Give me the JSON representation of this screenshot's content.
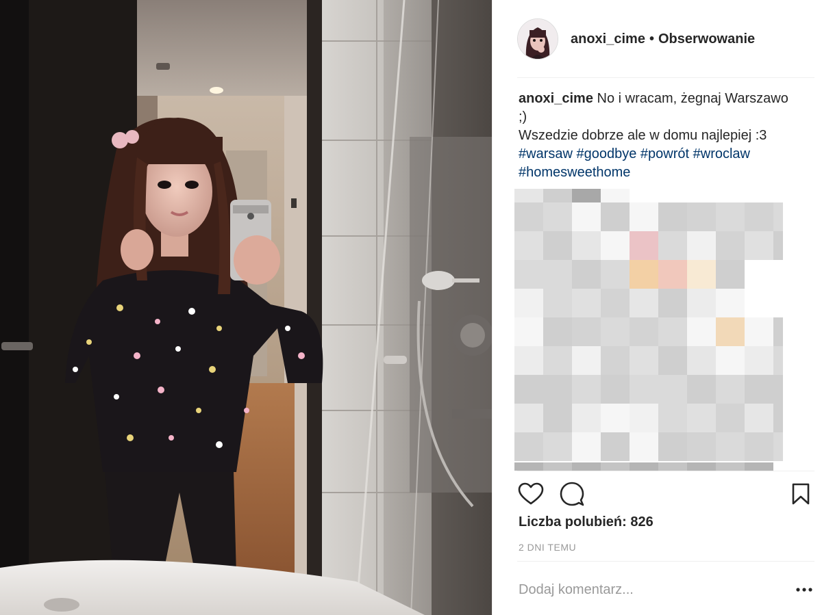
{
  "post": {
    "username": "anoxi_cime",
    "separator": "•",
    "follow_label": "Obserwowanie",
    "caption": {
      "username": "anoxi_cime",
      "line1": "No i wracam, żegnaj Warszawo ;)",
      "line2": "Wszedzie dobrze ale w domu najlepiej :3",
      "hashtags": [
        "#warsaw",
        "#goodbye",
        "#powrót",
        "#wroclaw",
        "#homesweethome"
      ]
    },
    "likes_text": "Liczba polubień: 826",
    "timestamp": "2 DNI TEMU",
    "comment_placeholder": "Dodaj komentarz...",
    "more_label": "•••"
  },
  "icons": {
    "like": "heart-icon",
    "comment": "comment-icon",
    "save": "bookmark-icon",
    "more": "more-options-icon"
  },
  "colors": {
    "hashtag": "#003569",
    "muted": "#999999",
    "text": "#262626",
    "divider": "#efefef"
  }
}
